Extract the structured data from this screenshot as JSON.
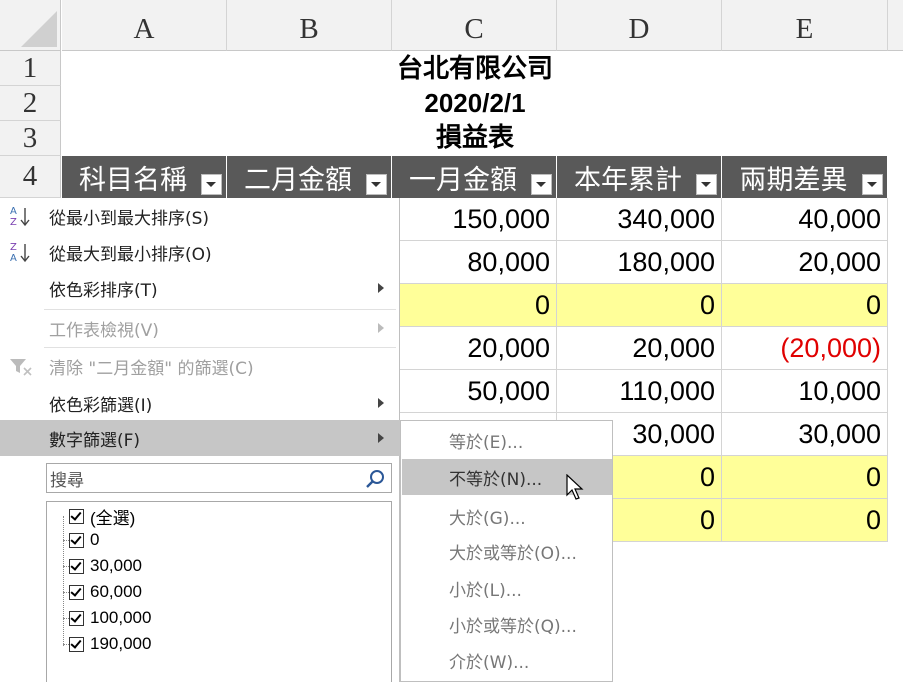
{
  "columns": [
    "A",
    "B",
    "C",
    "D",
    "E"
  ],
  "rows": [
    "1",
    "2",
    "3",
    "4"
  ],
  "report": {
    "company": "台北有限公司",
    "date": "2020/2/1",
    "title": "損益表"
  },
  "table_headers": [
    "科目名稱",
    "二月金額",
    "一月金額",
    "本年累計",
    "兩期差異"
  ],
  "data_rows": [
    {
      "c": "150,000",
      "d": "340,000",
      "e": "40,000",
      "yellow": false,
      "neg": false
    },
    {
      "c": "80,000",
      "d": "180,000",
      "e": "20,000",
      "yellow": false,
      "neg": false
    },
    {
      "c": "0",
      "d": "0",
      "e": "0",
      "yellow": true,
      "neg": false
    },
    {
      "c": "20,000",
      "d": "20,000",
      "e": "(20,000)",
      "yellow": false,
      "neg": true
    },
    {
      "c": "50,000",
      "d": "110,000",
      "e": "10,000",
      "yellow": false,
      "neg": false
    },
    {
      "c": "",
      "d": "30,000",
      "e": "30,000",
      "yellow": false,
      "neg": false
    },
    {
      "c": "",
      "d": "0",
      "e": "0",
      "yellow": true,
      "neg": false
    },
    {
      "c": "",
      "d": "0",
      "e": "0",
      "yellow": true,
      "neg": false
    }
  ],
  "menu": {
    "items": [
      {
        "label": "從最小到最大排序(S)",
        "icon": "sort-ascending-icon",
        "disabled": false,
        "submenu": false
      },
      {
        "label": "從最大到最小排序(O)",
        "icon": "sort-descending-icon",
        "disabled": false,
        "submenu": false
      },
      {
        "label": "依色彩排序(T)",
        "icon": "",
        "disabled": false,
        "submenu": true
      },
      {
        "label": "工作表檢視(V)",
        "icon": "",
        "disabled": true,
        "submenu": true
      },
      {
        "label": "清除 \"二月金額\" 的篩選(C)",
        "icon": "clear-filter-icon",
        "disabled": true,
        "submenu": false
      },
      {
        "label": "依色彩篩選(I)",
        "icon": "",
        "disabled": false,
        "submenu": true
      },
      {
        "label": "數字篩選(F)",
        "icon": "",
        "disabled": false,
        "submenu": true,
        "highlighted": true
      }
    ],
    "search_placeholder": "搜尋",
    "values": [
      "(全選)",
      "0",
      "30,000",
      "60,000",
      "100,000",
      "190,000"
    ]
  },
  "number_filter_submenu": [
    "等於(E)...",
    "不等於(N)...",
    "大於(G)...",
    "大於或等於(O)...",
    "小於(L)...",
    "小於或等於(Q)...",
    "介於(W)..."
  ],
  "colors": {
    "header_bg": "#595959",
    "highlight_yellow": "#ffff99",
    "negative": "#e00000",
    "menu_highlight": "#c6c6c6"
  }
}
